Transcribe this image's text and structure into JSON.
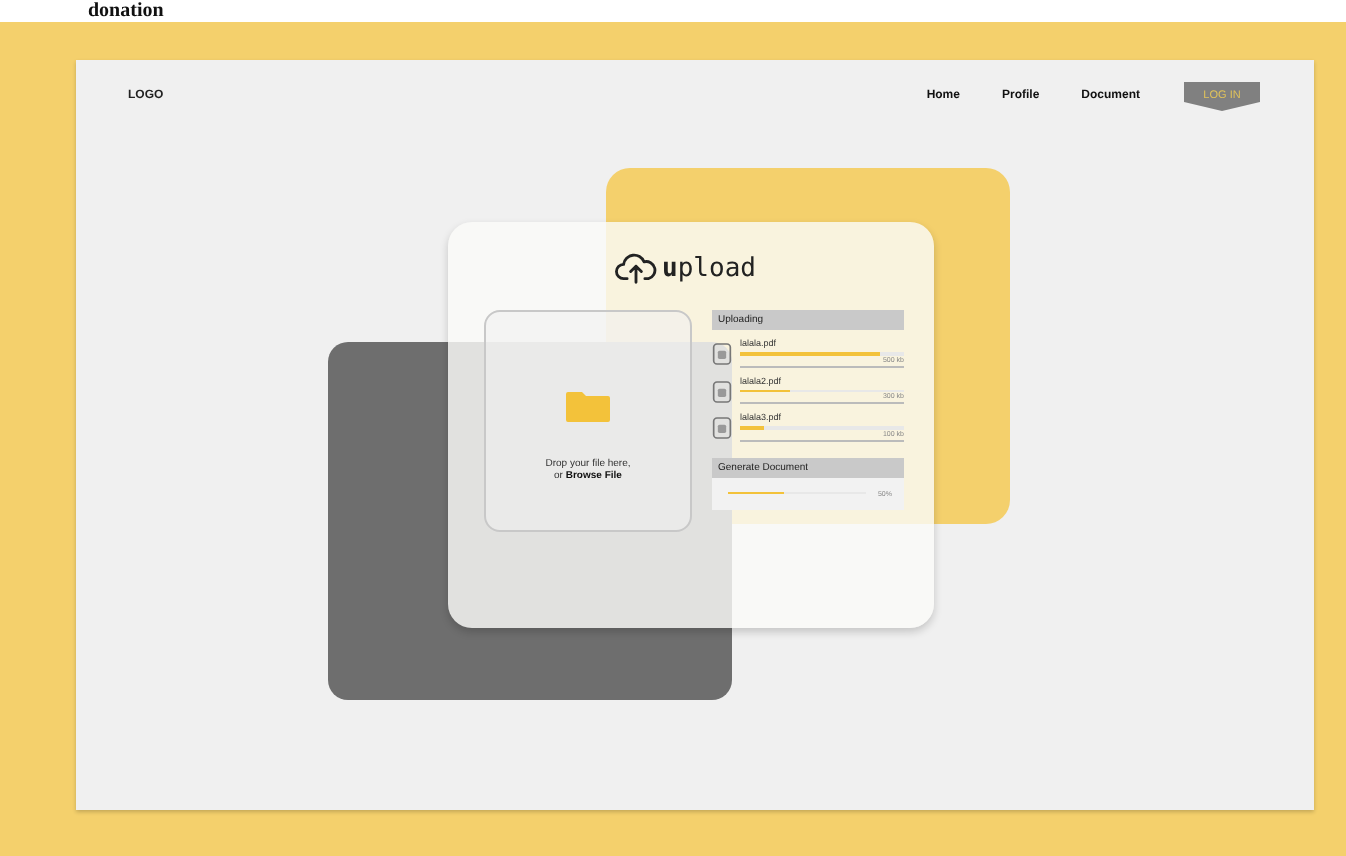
{
  "caption": "donation",
  "nav": {
    "logo": "LOGO",
    "links": [
      {
        "label": "Home"
      },
      {
        "label": "Profile"
      },
      {
        "label": "Document"
      }
    ],
    "login": "LOG IN"
  },
  "upload": {
    "title": "upload",
    "drop_text": "Drop your file here,",
    "drop_link_prefix": "or ",
    "drop_link": "Browse File",
    "uploading_title": "Uploading",
    "files": [
      {
        "name": "lalala.pdf",
        "level": 0.85,
        "size": "500 kb"
      },
      {
        "name": "lalala2.pdf",
        "level": 0.3,
        "size": "300 kb"
      },
      {
        "name": "lalala3.pdf",
        "level": 0.15,
        "size": "100 kb"
      }
    ],
    "generate_title": "Generate Document",
    "generate": {
      "level": 0.4,
      "reading": "50%"
    }
  }
}
